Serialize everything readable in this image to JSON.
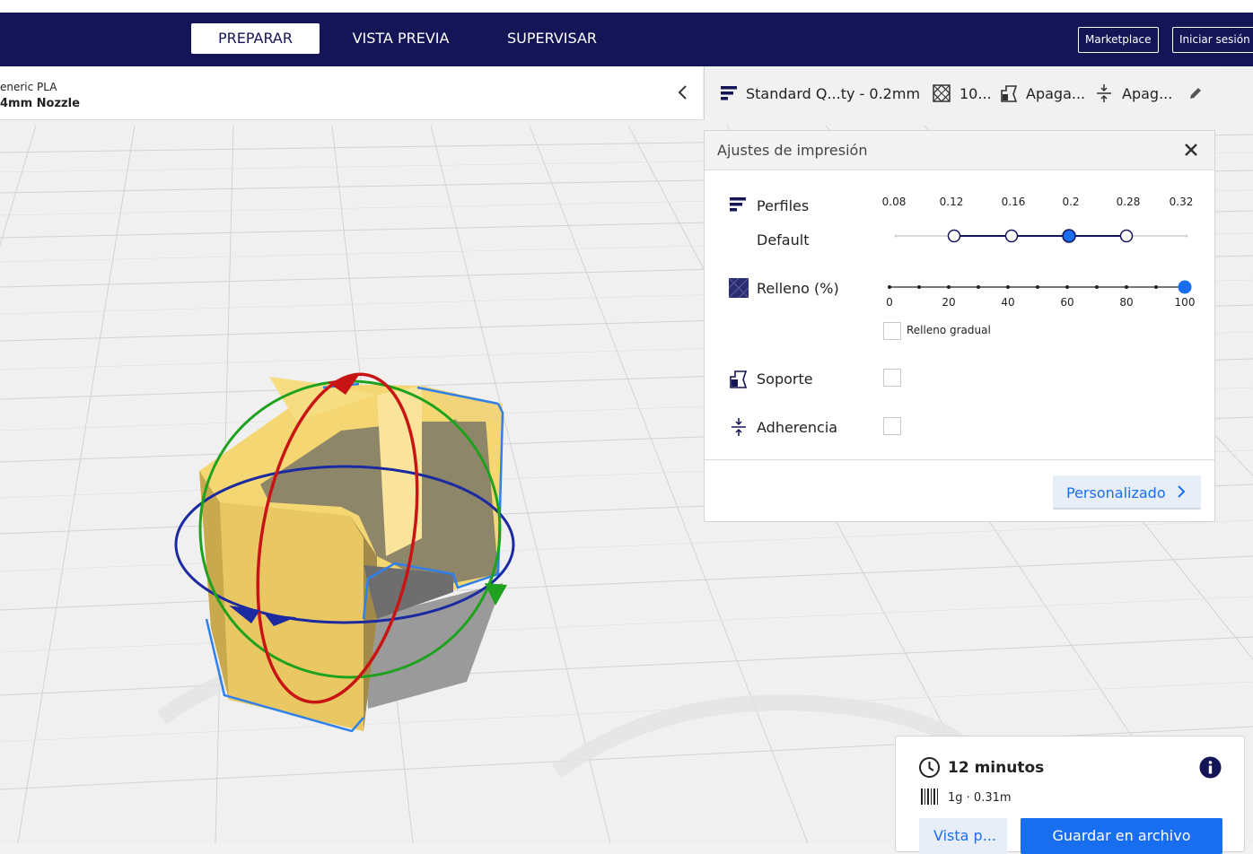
{
  "header": {
    "tabs": [
      {
        "label": "PREPARAR",
        "active": true
      },
      {
        "label": "VISTA PREVIA",
        "active": false
      },
      {
        "label": "SUPERVISAR",
        "active": false
      }
    ],
    "marketplace_label": "Marketplace",
    "signin_label": "Iniciar sesión"
  },
  "machine": {
    "material": "eneric PLA",
    "nozzle": "4mm Nozzle"
  },
  "print_bar": {
    "profile": "Standard Q...ty - 0.2mm",
    "infill": "10...",
    "support": "Apaga...",
    "adhesion": "Apag..."
  },
  "settings_panel": {
    "title": "Ajustes de impresión",
    "profiles_label": "Perfiles",
    "profile_name": "Default",
    "layer_heights": [
      "0.08",
      "0.12",
      "0.16",
      "0.2",
      "0.28",
      "0.32"
    ],
    "selected_layer_height": "0.2",
    "infill_label": "Relleno (%)",
    "infill_ticks": [
      "0",
      "20",
      "40",
      "60",
      "80",
      "100"
    ],
    "infill_value": 100,
    "gradual_infill_label": "Relleno gradual",
    "gradual_infill_checked": false,
    "support_label": "Soporte",
    "support_checked": false,
    "adhesion_label": "Adherencia",
    "adhesion_checked": false,
    "custom_button": "Personalizado"
  },
  "job": {
    "time": "12 minutos",
    "material": "1g · 0.31m",
    "preview_button": "Vista p...",
    "save_button": "Guardar en archivo"
  },
  "colors": {
    "header_bg": "#131557",
    "accent": "#196ef0",
    "model_yellow": "#f7d978",
    "selection_outline": "#2f80ed"
  }
}
